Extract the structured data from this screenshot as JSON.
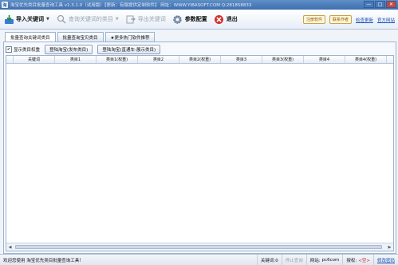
{
  "window": {
    "title": "淘宝优先类目批量查询工具 v1.3.1.0（试用版）【更新：有偿提供定制软件】 网址：WWW.YIBASOFT.COM  Q:281858833",
    "controls": {
      "minimize": "—",
      "maximize": "□",
      "close": "✕"
    }
  },
  "toolbar": {
    "import": {
      "label": "导入关键词",
      "icon": "import-arrow-icon"
    },
    "query": {
      "label": "查询关键词的类目",
      "icon": "search-icon"
    },
    "export": {
      "label": "导出关键词",
      "icon": "export-icon"
    },
    "config": {
      "label": "参数配置",
      "icon": "gear-icon"
    },
    "exit": {
      "label": "退出",
      "icon": "close-icon"
    },
    "register_badge": "注册软件",
    "contact_badge": "联系作者",
    "check_update": "检查更新",
    "official_site": "官方网站"
  },
  "tabs": [
    {
      "label": "批量查询关键词类目"
    },
    {
      "label": "批量查询宝贝类目"
    },
    {
      "label": "★更多热门软件推荐"
    }
  ],
  "options": {
    "show_weight": {
      "label": "显示类目权重",
      "checked": true
    },
    "login_taobao_seller": "登陆淘宝(发布类目)",
    "login_taobao_express": "登陆淘宝(直通车-展示类目)"
  },
  "grid": {
    "columns": [
      "关键词",
      "类目1",
      "类目1(权重)",
      "类目2",
      "类目2(权重)",
      "类目3",
      "类目3(权重)",
      "类目4",
      "类目4(权重)"
    ]
  },
  "statusbar": {
    "welcome": "欢迎您使用 淘宝优先类目批量查询工具！",
    "keyword_count": "关键词:0",
    "stop_query": "停止查询",
    "site_label": "网站:",
    "site_value": "pc6com",
    "auth_label": "授权:",
    "auth_value": "<空>",
    "change_password": "修改密码"
  }
}
